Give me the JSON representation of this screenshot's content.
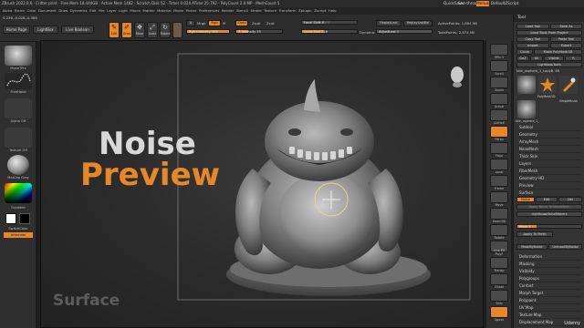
{
  "titlebar": {
    "text": "ZBrush 2022.0.6 · Critter print · Free Mem 18.444GB · Active Mem 1482 · Scratch Disk 52 · Timer 0.024 ATime 25.792 · PolyCount 2.9 MP · MeshCount 5",
    "quicksave": "QuickSave",
    "seethrough": "See-through 0",
    "menus": "Menus",
    "script": "DefaultZScript"
  },
  "menubar": [
    "Alpha",
    "Brush",
    "Color",
    "Document",
    "Draw",
    "Dynamics",
    "Edit",
    "File",
    "Layer",
    "Light",
    "Macro",
    "Marker",
    "Material",
    "Movie",
    "Picker",
    "Preferences",
    "Render",
    "Stencil",
    "Stroke",
    "Texture",
    "Transform",
    "Zplugin",
    "Zscript",
    "Help"
  ],
  "coords": "0.236,-0.028,-0.388",
  "toolbar": {
    "home_page": "Home Page",
    "lightbox": "LightBox",
    "live_boolean": "Live Boolean",
    "edit": "Edit",
    "draw": "Draw",
    "move": "Move",
    "scale": "Scale",
    "rotate": "Rotate",
    "a": "A",
    "mrgb": "Mrgb",
    "rgb": "Rgb",
    "m": "M",
    "zadd": "Zadd",
    "zsub": "Zsub",
    "zcut": "Zcut",
    "rgb_intensity": "Rgb Intensity 100",
    "z_intensity": "Z Intensity 25",
    "focal_shift": "Focal Shift 0",
    "draw_size": "Draw Size 116",
    "dynamic": "Dynamic",
    "replay_last": "ReplayLast",
    "replay_last_rel": "ReplayLastRel",
    "adjust_last": "AdjustLast 1",
    "active_points": "ActivePoints: 1.694 Mil",
    "total_points": "TotalPoints: 2.874 Mil"
  },
  "left_shelf": {
    "brush_label": "MoveTPrs",
    "stroke_label": "FreeHand",
    "alpha_label": "Alpha Off",
    "texture_label": "Texture Off",
    "material_label": "MatCap Gray",
    "gradient_label": "Gradient",
    "switch_color": "SwitchColor",
    "alternate": "Alternate"
  },
  "overlay": {
    "line1": "Noise",
    "line2": "Preview",
    "footer": "Surface",
    "brand": "Udemy"
  },
  "right_shelf": [
    "SPix 3",
    "Scroll",
    "Zoom",
    "Actual",
    "AAHalf",
    "Persp",
    "Floor",
    "Local",
    "Frame",
    "Move",
    "Zoom3D",
    "Rotate",
    "Line Fill PolyF",
    "Transp",
    "Ghost",
    "Solo",
    "Xpose"
  ],
  "tool_palette": {
    "title": "Tool",
    "load_tool": "Load Tool",
    "save_as": "Save As",
    "load_from_project": "Load Tools From Project",
    "copy_tool": "Copy Tool",
    "paste_tool": "Paste Tool",
    "import": "Import",
    "export": "Export",
    "clone": "Clone",
    "make_polymesh": "Make PolyMesh3D",
    "goz": "GoZ",
    "all": "All",
    "visible": "Visible",
    "r": "R",
    "lightbox_tools": "Lightbox▸Tools",
    "current_tool": "skin_zsphere_1_copyB. 48",
    "thumbs": [
      "skin_zsphere_1",
      "PolyMesh3D",
      "SimpleBrush",
      "skin_zsphere_1_"
    ],
    "sections": [
      "Subtool",
      "Geometry",
      "ArrayMesh",
      "NanoMesh",
      "Thick Skin",
      "Layers",
      "FiberMesh",
      "Geometry HD",
      "Preview",
      "Surface"
    ],
    "surface": {
      "noise": "Noise",
      "edit": "Edit",
      "del": "Del",
      "apply_noise": "Apply Noise To NanoMesh",
      "lightbox_noisemakers": "Lightbox▸NoiseMakers",
      "mask": "Mask 1",
      "apply_to_mesh": "Apply To Mesh",
      "mask_by_noise": "MaskByNoise",
      "unmask_by_noise": "UnmaskByNoise"
    },
    "lower_sections": [
      "Deformation",
      "Masking",
      "Visibility",
      "Polygroups",
      "Contact",
      "Morph Target",
      "Polypaint",
      "UV Map",
      "Texture Map",
      "Displacement Map"
    ]
  },
  "colors": {
    "accent": "#e8872a",
    "panel": "#2f2f2f",
    "viewport": "#2c2c2c"
  }
}
